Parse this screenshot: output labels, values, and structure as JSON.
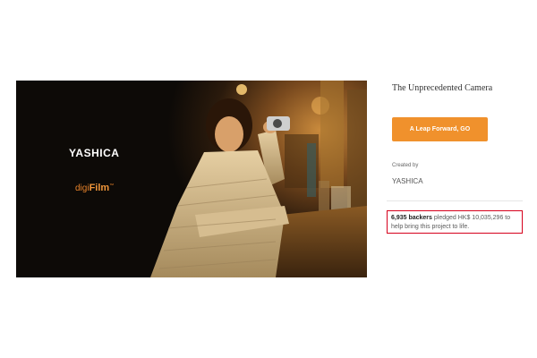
{
  "hero": {
    "brand": "YASHICA",
    "product_prefix": "digi",
    "product_name": "Film",
    "trademark": "™"
  },
  "campaign": {
    "title": "The Unprecedented Camera",
    "cta_label": "A Leap Forward, GO",
    "created_by_label": "Created by",
    "creator": "YASHICA"
  },
  "funding": {
    "backers": "6,935 backers",
    "pledged_text": "pledged HK$ 10,035,296 to",
    "line2": "help bring this project to life."
  },
  "colors": {
    "accent": "#f0912c",
    "highlight_border": "#d6001c"
  }
}
